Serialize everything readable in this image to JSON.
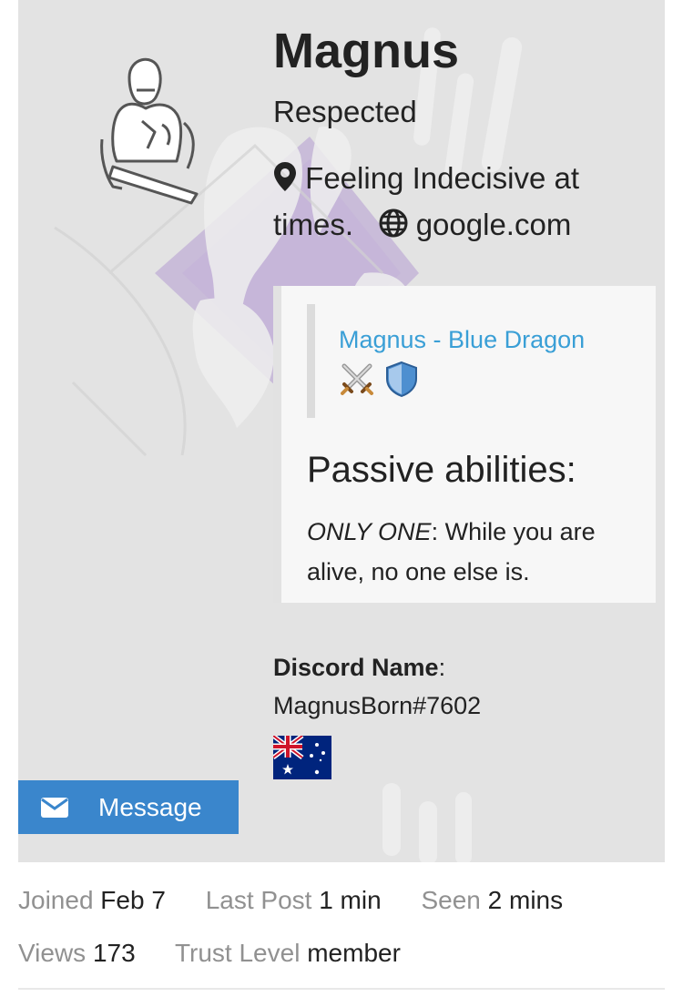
{
  "profile": {
    "username": "Magnus",
    "title": "Respected",
    "location": "Feeling Indecisive at times.",
    "website": "google.com"
  },
  "bio": {
    "quote_link": "Magnus - Blue Dragon",
    "emojis": [
      "crossed-swords-icon",
      "shield-icon"
    ],
    "heading": "Passive abilities:",
    "ability_name": "ONLY ONE",
    "ability_desc": ": While you are alive, no one else is."
  },
  "discord": {
    "label": "Discord Name",
    "colon": ":",
    "name": "MagnusBorn#7602"
  },
  "flag": "australia-flag-icon",
  "message_button": {
    "label": "Message"
  },
  "stats": [
    {
      "label": "Joined",
      "value": "Feb 7"
    },
    {
      "label": "Last Post",
      "value": "1 min"
    },
    {
      "label": "Seen",
      "value": "2 mins"
    },
    {
      "label": "Views",
      "value": "173"
    },
    {
      "label": "Trust Level",
      "value": "member"
    }
  ],
  "colors": {
    "accent": "#3a86cc",
    "link": "#3a9fd6",
    "hero_bg": "#e3e3e3",
    "muted": "#919191"
  }
}
